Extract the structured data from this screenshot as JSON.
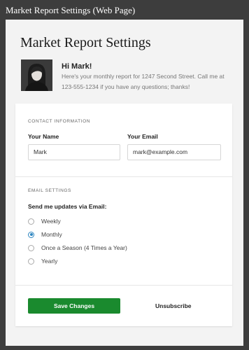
{
  "window": {
    "title": "Market Report Settings (Web Page)"
  },
  "header": {
    "title": "Market Report Settings",
    "greeting": "Hi Mark!",
    "intro": "Here's your monthly report for 1247 Second Street. Call me at 123-555-1234 if you have any questions; thanks!"
  },
  "contact": {
    "section_label": "CONTACT INFORMATION",
    "name_label": "Your Name",
    "name_value": "Mark",
    "email_label": "Your Email",
    "email_value": "mark@example.com"
  },
  "email_settings": {
    "section_label": "EMAIL SETTINGS",
    "question": "Send me updates via Email:",
    "options": [
      {
        "label": "Weekly",
        "checked": false
      },
      {
        "label": "Monthly",
        "checked": true
      },
      {
        "label": "Once a Season (4 Times a Year)",
        "checked": false
      },
      {
        "label": "Yearly",
        "checked": false
      }
    ]
  },
  "actions": {
    "save_label": "Save Changes",
    "unsubscribe_label": "Unsubscribe"
  },
  "colors": {
    "accent": "#2e86c1",
    "save_button": "#1a8a2e",
    "background": "#3d3d3d"
  }
}
